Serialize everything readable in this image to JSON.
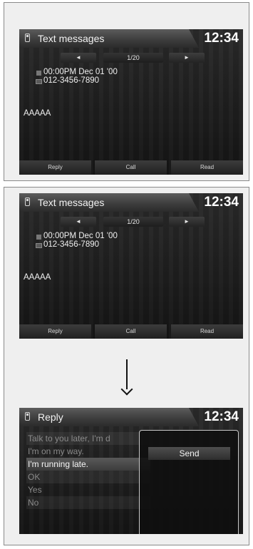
{
  "screen1": {
    "title": "Text messages",
    "clock": "12:34",
    "pager": {
      "prev": "◄",
      "page": "1/20",
      "next": "►"
    },
    "timestamp": "00:00PM Dec 01 '00",
    "phone_number": "012-3456-7890",
    "message_body": "AAAAA",
    "softkeys": [
      "Reply",
      "Call",
      "Read"
    ]
  },
  "screen2": {
    "title": "Text messages",
    "clock": "12:34",
    "pager": {
      "prev": "◄",
      "page": "1/20",
      "next": "►"
    },
    "timestamp": "00:00PM Dec 01 '00",
    "phone_number": "012-3456-7890",
    "message_body": "AAAAA",
    "softkeys": [
      "Reply",
      "Call",
      "Read"
    ]
  },
  "screen3": {
    "title": "Reply",
    "clock": "12:34",
    "replies": [
      "Talk to you later, I'm d",
      "I'm on my way.",
      "I'm running late.",
      "OK",
      "Yes",
      "No"
    ],
    "selected_index": 2,
    "popup_button": "Send"
  },
  "icons": {
    "phone": "phone-icon",
    "arrow": "down-arrow-icon"
  }
}
